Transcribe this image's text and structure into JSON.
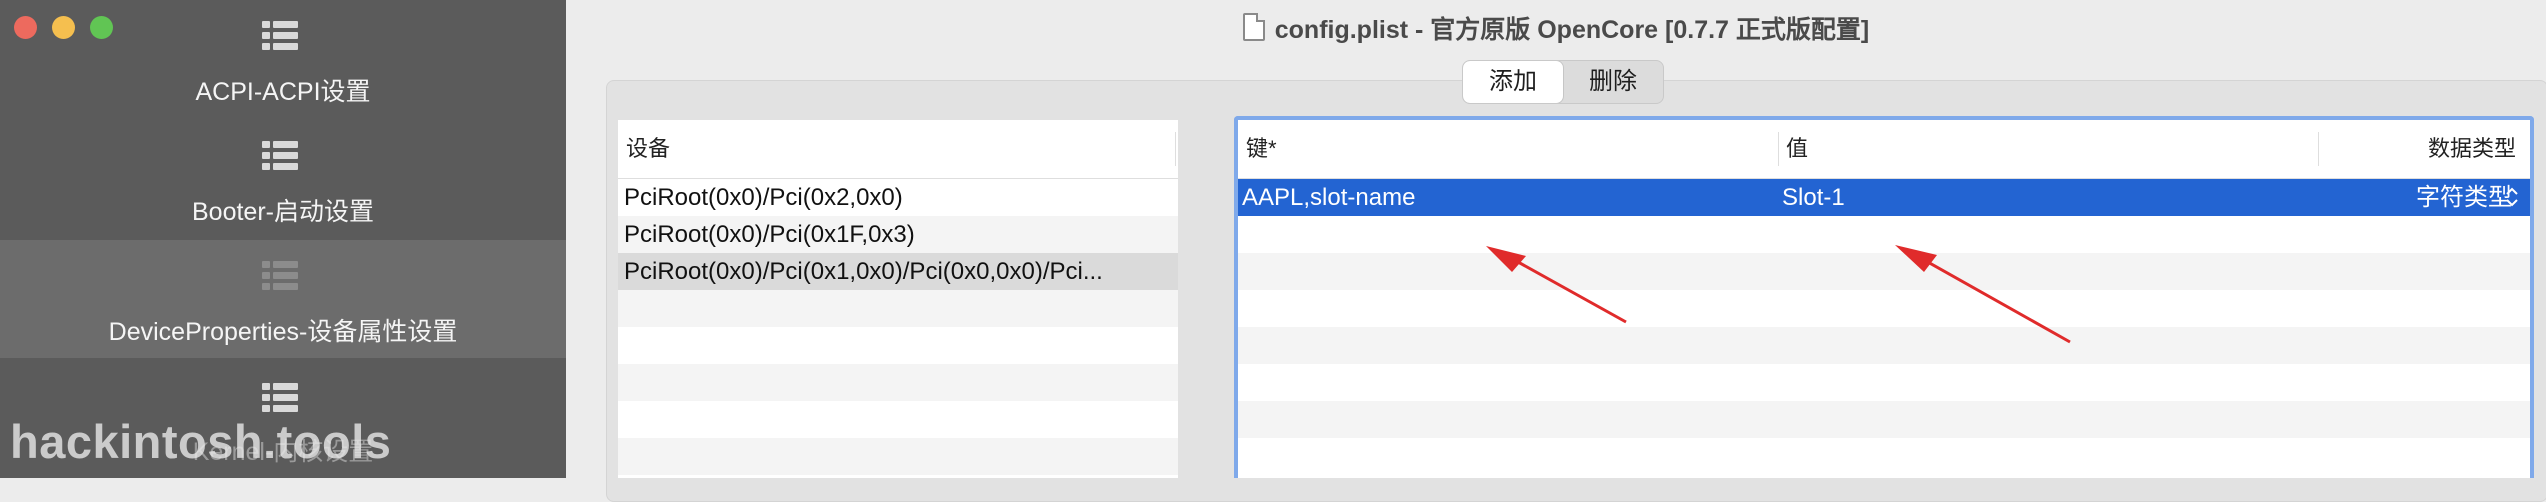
{
  "window": {
    "title": "config.plist - 官方原版 OpenCore [0.7.7 正式版配置]"
  },
  "sidebar": {
    "items": [
      {
        "label": "ACPI-ACPI设置",
        "icon": "list-icon"
      },
      {
        "label": "Booter-启动设置",
        "icon": "list-icon"
      },
      {
        "label": "DeviceProperties-设备属性设置",
        "icon": "list-icon",
        "selected": true
      },
      {
        "label": "Kernel-内核设置",
        "icon": "list-icon"
      }
    ],
    "watermark": "hackintosh.tools"
  },
  "segment": {
    "add_label": "添加",
    "delete_label": "删除"
  },
  "devices": {
    "header": "设备",
    "rows": [
      "PciRoot(0x0)/Pci(0x2,0x0)",
      "PciRoot(0x0)/Pci(0x1F,0x3)",
      "PciRoot(0x0)/Pci(0x1,0x0)/Pci(0x0,0x0)/Pci..."
    ],
    "selected_index": 2
  },
  "properties": {
    "headers": {
      "key": "键*",
      "value": "值",
      "type": "数据类型"
    },
    "rows": [
      {
        "key": "AAPL,slot-name",
        "value": "Slot-1",
        "type": "字符类型"
      }
    ]
  },
  "colors": {
    "selection": "#2364d2",
    "annotation_arrow": "#e02b2b",
    "focus_ring": "#7fa9ea"
  }
}
